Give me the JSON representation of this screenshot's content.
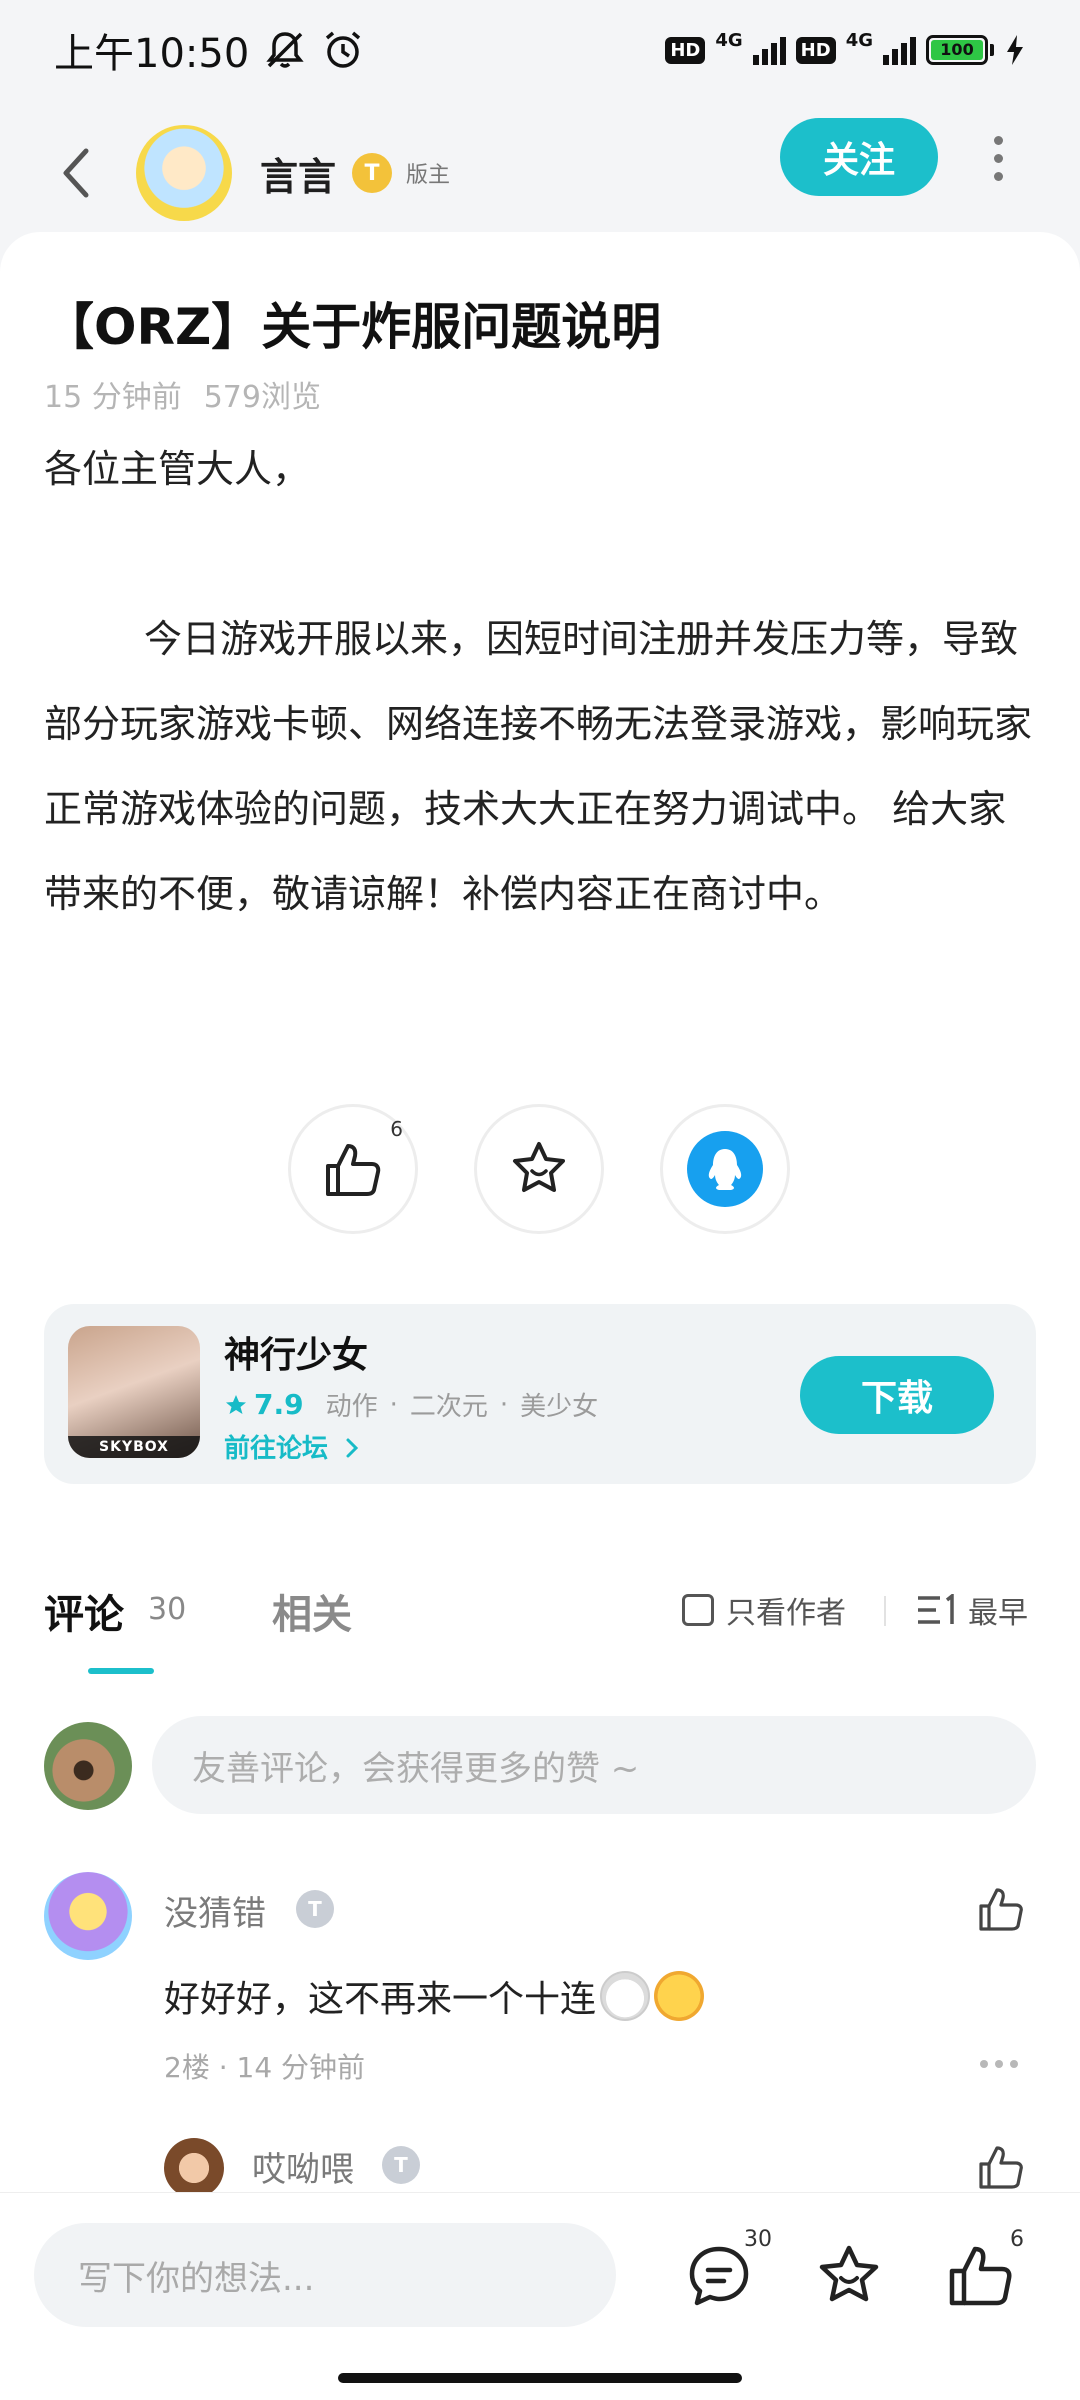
{
  "status_bar": {
    "time": "上午10:50",
    "hd1": "HD",
    "net1": "4G",
    "hd2": "HD",
    "net2": "4G",
    "battery": "100"
  },
  "header": {
    "author_name": "言言",
    "author_badge": "T",
    "mod_tag": "版主",
    "follow_label": "关注"
  },
  "post": {
    "title": "【ORZ】关于炸服问题说明",
    "time_ago": "15 分钟前",
    "views": "579浏览",
    "greeting": "各位主管大人，",
    "body": "今日游戏开服以来，因短时间注册并发压力等，导致部分玩家游戏卡顿、网络连接不畅无法登录游戏，影响玩家正常游戏体验的问题，技术大大正在努力调试中。 给大家带来的不便，敬请谅解！补偿内容正在商讨中。",
    "like_count": "6"
  },
  "game": {
    "name": "神行少女",
    "score": "7.9",
    "tags": [
      "动作",
      "二次元",
      "美少女"
    ],
    "forum_link": "前往论坛",
    "download_label": "下载",
    "icon_brand": "SKYBOX"
  },
  "comments_section": {
    "tab_comments": "评论",
    "comment_count": "30",
    "tab_related": "相关",
    "only_author": "只看作者",
    "sort_label": "最早",
    "input_placeholder": "友善评论，会获得更多的赞 ~",
    "comments": [
      {
        "name": "没猜错",
        "badge": "T",
        "text": "好好好，这不再来一个十连",
        "meta": "2楼 · 14 分钟前"
      },
      {
        "name": "哎呦喂",
        "badge": "T"
      }
    ]
  },
  "bottom_bar": {
    "input_placeholder": "写下你的想法...",
    "comment_count": "30",
    "like_count": "6"
  },
  "colors": {
    "accent": "#1cbfcb",
    "qq_blue": "#17a0ef",
    "gold_badge": "#f3c23a"
  }
}
